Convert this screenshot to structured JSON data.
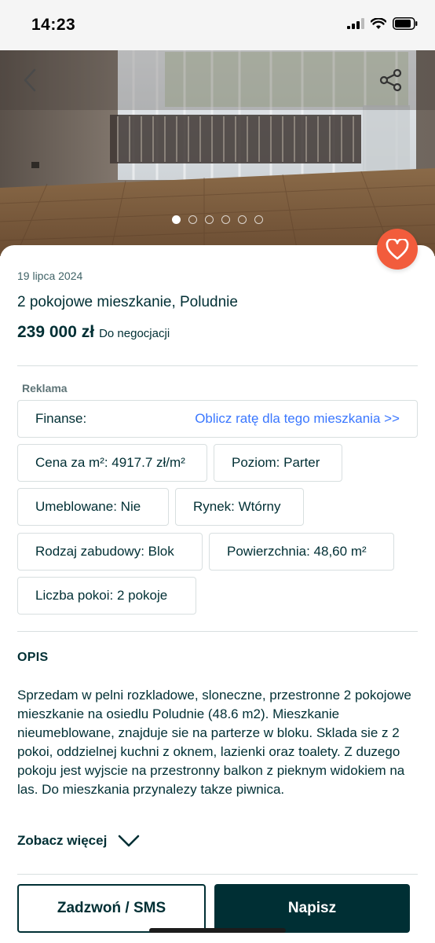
{
  "status_bar": {
    "time": "14:23"
  },
  "gallery": {
    "photo_count": 6,
    "active_index": 0
  },
  "listing": {
    "date": "19 lipca 2024",
    "title": "2 pokojowe mieszkanie, Poludnie",
    "price": "239 000 zł",
    "price_note": "Do negocjacji"
  },
  "ad": {
    "label": "Reklama",
    "finance_label": "Finanse:",
    "finance_link": "Oblicz ratę dla tego mieszkania >>"
  },
  "params": [
    "Cena za m²: 4917.7 zł/m²",
    "Poziom: Parter",
    "Umeblowane: Nie",
    "Rynek: Wtórny",
    "Rodzaj zabudowy: Blok",
    "Powierzchnia: 48,60 m²",
    "Liczba pokoi: 2 pokoje"
  ],
  "description": {
    "heading": "OPIS",
    "text": "Sprzedam w pelni rozkladowe, sloneczne, przestronne 2 pokojowe mieszkanie na osiedlu Poludnie (48.6 m2). Mieszkanie nieumeblowane, znajduje sie na parterze w bloku. Sklada sie z 2 pokoi, oddzielnej kuchni z oknem, lazienki oraz toalety. Z duzego pokoju jest wyjscie na przestronny balkon z pieknym widokiem na las. Do mieszkania przynalezy takze piwnica.",
    "see_more": "Zobacz więcej"
  },
  "actions": {
    "call": "Zadzwoń / SMS",
    "write": "Napisz"
  },
  "colors": {
    "brand_dark": "#002f34",
    "favorite": "#f25c3c",
    "link": "#3a77ff"
  }
}
